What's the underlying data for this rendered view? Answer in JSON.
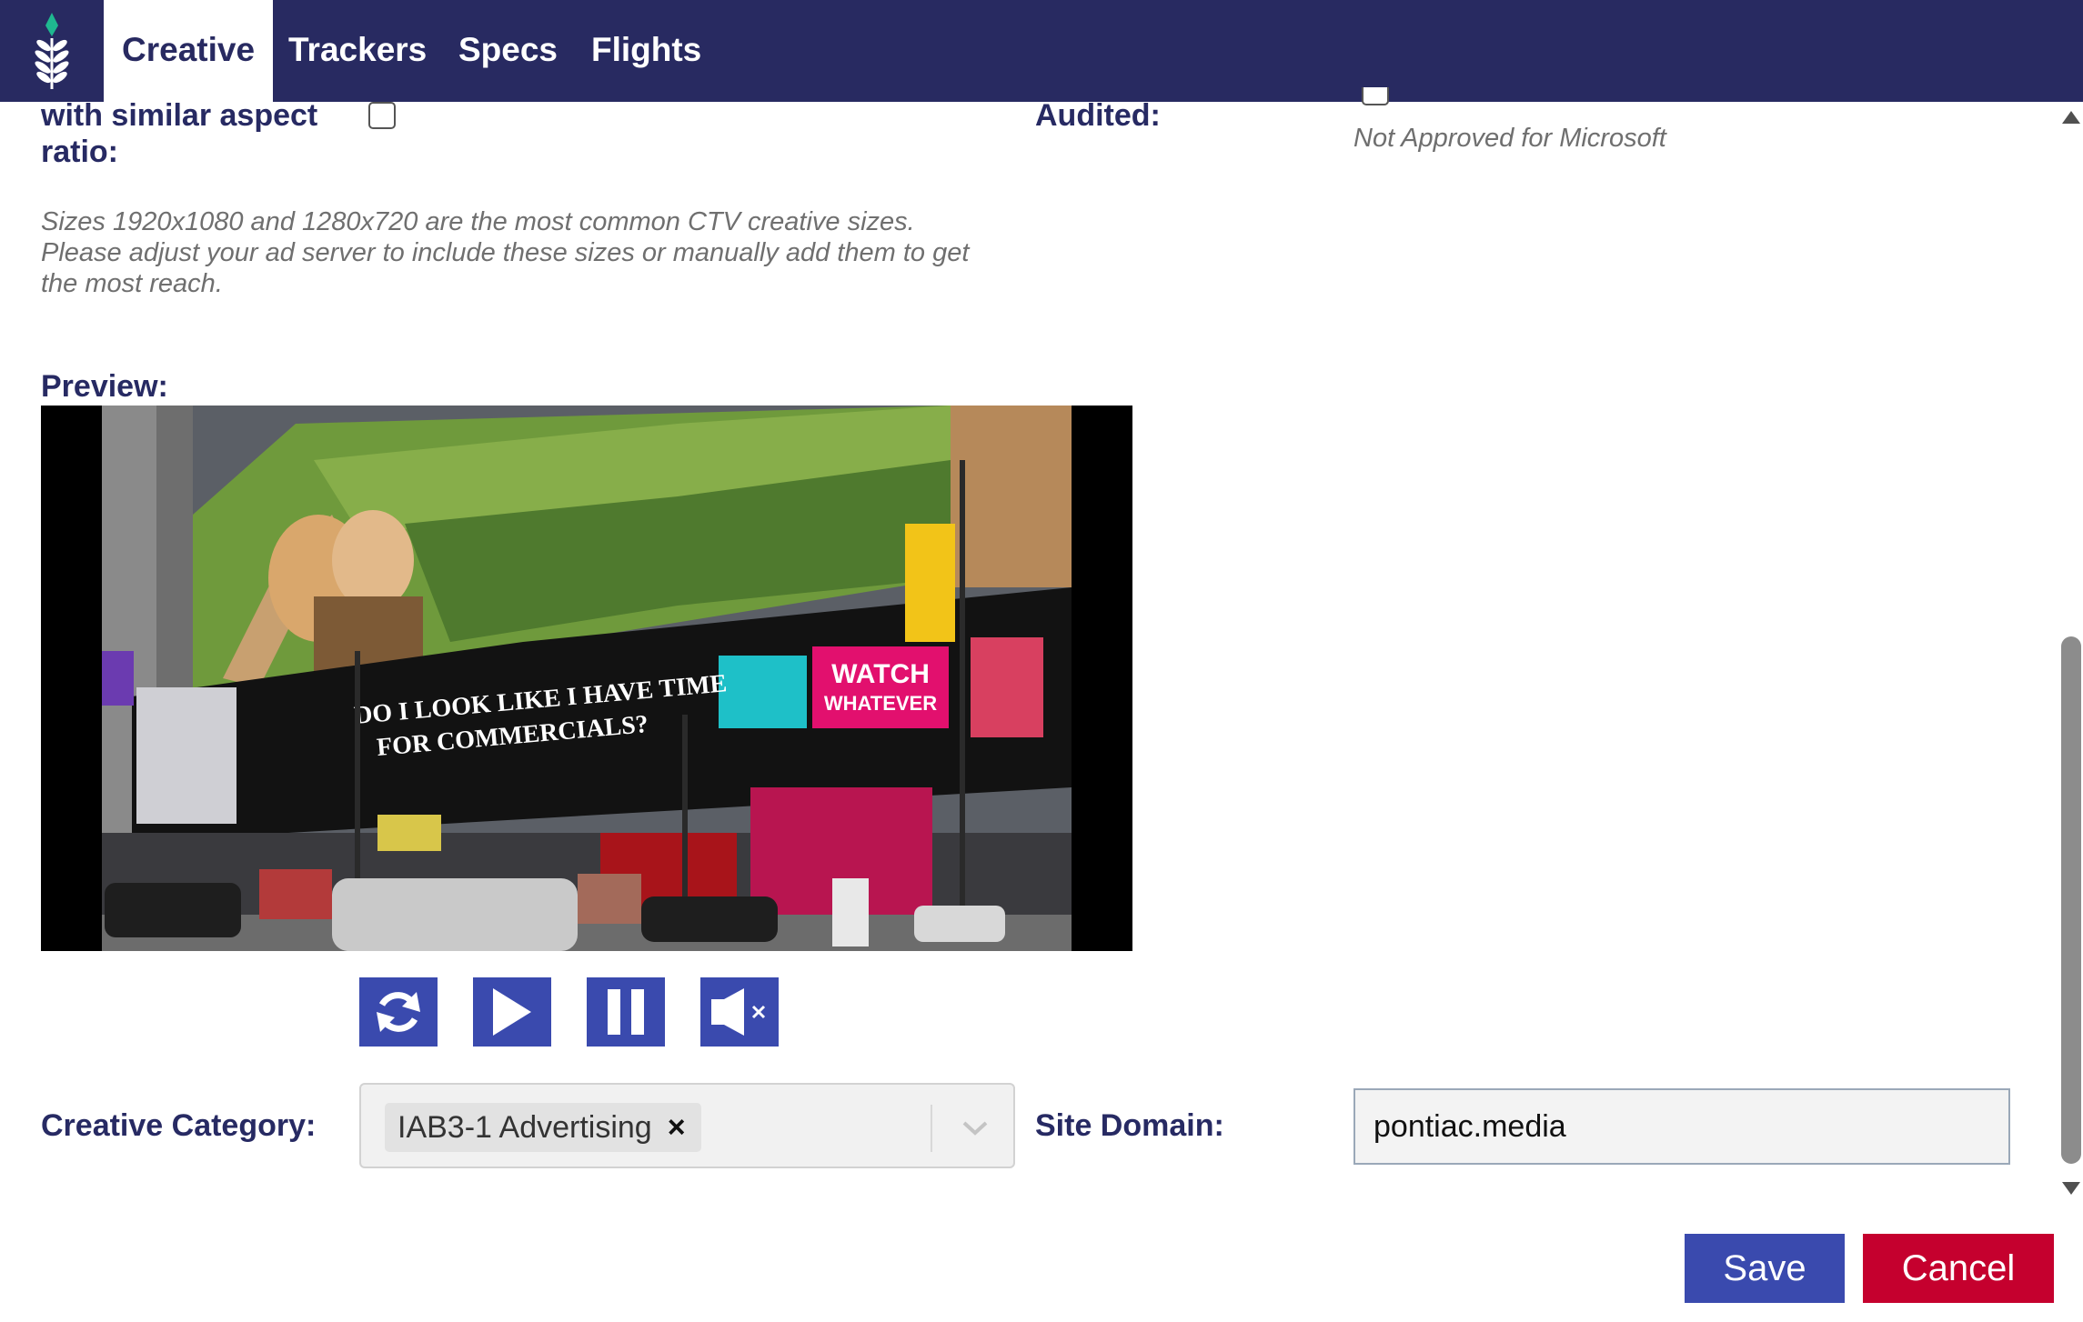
{
  "nav": {
    "tabs": [
      {
        "label": "Creative",
        "active": true
      },
      {
        "label": "Trackers",
        "active": false
      },
      {
        "label": "Specs",
        "active": false
      },
      {
        "label": "Flights",
        "active": false
      }
    ],
    "logo_icon": "wheat-leaf-logo",
    "colors": {
      "bar": "#282a61",
      "accent": "#1fb890"
    }
  },
  "form": {
    "aspect_label_line1": "with similar aspect",
    "aspect_label_line2": "ratio:",
    "aspect_checked": false,
    "audited_label": "Audited:",
    "audited_status": "Not Approved for Microsoft",
    "size_hint_line1": "Sizes 1920x1080 and 1280x720 are the most common CTV creative sizes.",
    "size_hint_line2": "Please adjust your ad server to include these sizes or manually add them to get",
    "size_hint_line3": "the most reach.",
    "preview_label": "Preview:",
    "preview_billboard_1": "DO I LOOK LIKE I HAVE TIME",
    "preview_billboard_2": "FOR COMMERCIALS?",
    "preview_billboard_3": "WATCH",
    "preview_billboard_4": "WHATEVER",
    "controls": [
      "replay-icon",
      "play-icon",
      "pause-icon",
      "mute-icon"
    ],
    "category_label": "Creative Category:",
    "category_value": "IAB3-1 Advertising",
    "category_remove": "×",
    "site_domain_label": "Site Domain:",
    "site_domain_value": "pontiac.media"
  },
  "actions": {
    "save_label": "Save",
    "cancel_label": "Cancel",
    "colors": {
      "save": "#3a4aae",
      "cancel": "#c5002e"
    }
  }
}
